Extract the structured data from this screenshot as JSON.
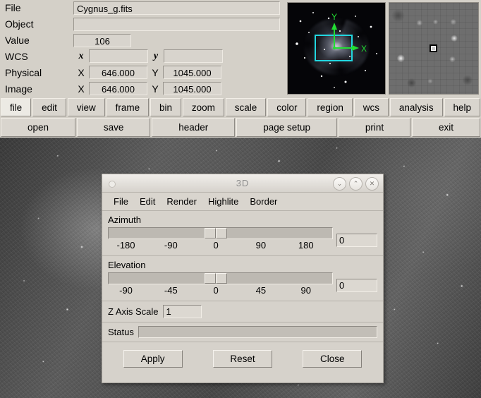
{
  "info": {
    "rows": [
      {
        "label": "File",
        "field_kind": "wide",
        "value": "Cygnus_g.fits"
      },
      {
        "label": "Object",
        "field_kind": "wide",
        "value": ""
      },
      {
        "label": "Value",
        "field_kind": "value",
        "value": "106"
      }
    ],
    "wcs": {
      "label": "WCS",
      "x_axis": "x",
      "x_value": "",
      "y_axis": "y",
      "y_value": ""
    },
    "physical": {
      "label": "Physical",
      "x_axis": "X",
      "x_value": "646.000",
      "y_axis": "Y",
      "y_value": "1045.000"
    },
    "image": {
      "label": "Image",
      "x_axis": "X",
      "x_value": "646.000",
      "y_axis": "Y",
      "y_value": "1045.000"
    }
  },
  "panner": {
    "name": "panner",
    "compass_x_label": "X",
    "compass_y_label": "Y",
    "compass_color": "#22dd33",
    "viewbox_color": "#22d7e0"
  },
  "magnifier": {
    "name": "magnifier"
  },
  "menubar": {
    "primary": [
      {
        "label": "file",
        "active": true
      },
      {
        "label": "edit",
        "active": false
      },
      {
        "label": "view",
        "active": false
      },
      {
        "label": "frame",
        "active": false
      },
      {
        "label": "bin",
        "active": false
      },
      {
        "label": "zoom",
        "active": false
      },
      {
        "label": "scale",
        "active": false
      },
      {
        "label": "color",
        "active": false
      },
      {
        "label": "region",
        "active": false
      },
      {
        "label": "wcs",
        "active": false
      },
      {
        "label": "analysis",
        "active": false
      },
      {
        "label": "help",
        "active": false
      }
    ],
    "secondary": [
      {
        "label": "open"
      },
      {
        "label": "save"
      },
      {
        "label": "header"
      },
      {
        "label": "page setup"
      },
      {
        "label": "print"
      },
      {
        "label": "exit"
      }
    ]
  },
  "dialog": {
    "title": "3D",
    "titlebar_buttons": [
      {
        "name": "minimize",
        "glyph": "⌄"
      },
      {
        "name": "maximize",
        "glyph": "⌃"
      },
      {
        "name": "close",
        "glyph": "✕"
      }
    ],
    "menu": [
      "File",
      "Edit",
      "Render",
      "Highlite",
      "Border"
    ],
    "azimuth": {
      "label": "Azimuth",
      "value": "0",
      "min": -180,
      "max": 180,
      "ticks": [
        "-180",
        "-90",
        "0",
        "90",
        "180"
      ],
      "tick_positions": [
        8,
        28,
        48,
        68,
        88
      ],
      "thumb_percent": 48
    },
    "elevation": {
      "label": "Elevation",
      "value": "0",
      "min": -90,
      "max": 90,
      "ticks": [
        "-90",
        "-45",
        "0",
        "45",
        "90"
      ],
      "tick_positions": [
        8,
        28,
        48,
        68,
        88
      ],
      "thumb_percent": 48
    },
    "z_axis": {
      "label": "Z Axis Scale",
      "value": "1"
    },
    "status": {
      "label": "Status",
      "value": ""
    },
    "buttons": [
      {
        "label": "Apply"
      },
      {
        "label": "Reset"
      },
      {
        "label": "Close"
      }
    ]
  }
}
